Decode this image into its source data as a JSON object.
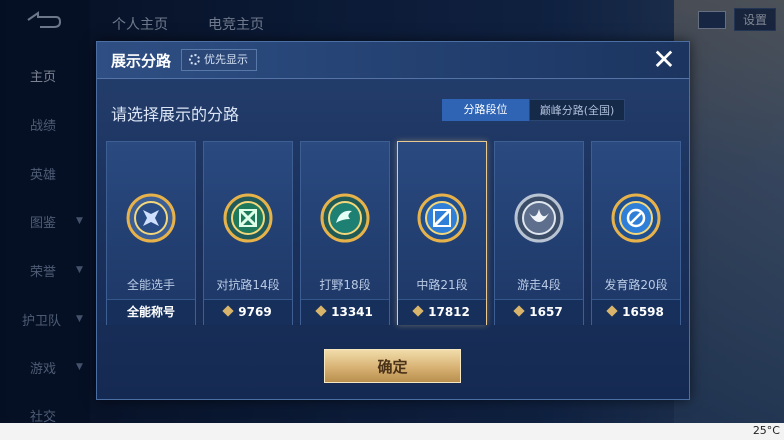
{
  "background": {
    "sidebar": {
      "items": [
        {
          "label": "主页",
          "active": true
        },
        {
          "label": "战绩"
        },
        {
          "label": "英雄"
        },
        {
          "label": "图鉴"
        },
        {
          "label": "荣誉"
        },
        {
          "label": "护卫队"
        },
        {
          "label": "游戏"
        },
        {
          "label": "社交"
        }
      ]
    },
    "top_tabs": [
      "个人主页",
      "电竞主页"
    ],
    "settings_label": "设置"
  },
  "modal": {
    "title": "展示分路",
    "priority_button": "优先显示",
    "close_icon": "close-icon",
    "prompt": "请选择展示的分路",
    "segments": [
      {
        "label": "分路段位",
        "active": true
      },
      {
        "label": "巅峰分路(全国)",
        "active": false
      }
    ],
    "cards": [
      {
        "name": "全能选手",
        "footer": "全能称号",
        "has_points": false,
        "selected": false,
        "color": "#e7b24a"
      },
      {
        "name": "对抗路14段",
        "footer": "9769",
        "has_points": true,
        "selected": false,
        "color": "#2fb07a"
      },
      {
        "name": "打野18段",
        "footer": "13341",
        "has_points": true,
        "selected": false,
        "color": "#2aa39a"
      },
      {
        "name": "中路21段",
        "footer": "17812",
        "has_points": true,
        "selected": true,
        "color": "#3f8fe8"
      },
      {
        "name": "游走4段",
        "footer": "1657",
        "has_points": true,
        "selected": false,
        "color": "#9aa7bb"
      },
      {
        "name": "发育路20段",
        "footer": "16598",
        "has_points": true,
        "selected": false,
        "color": "#3a8ee0"
      }
    ],
    "confirm_label": "确定"
  },
  "statusbar": {
    "temperature": "25°C"
  }
}
